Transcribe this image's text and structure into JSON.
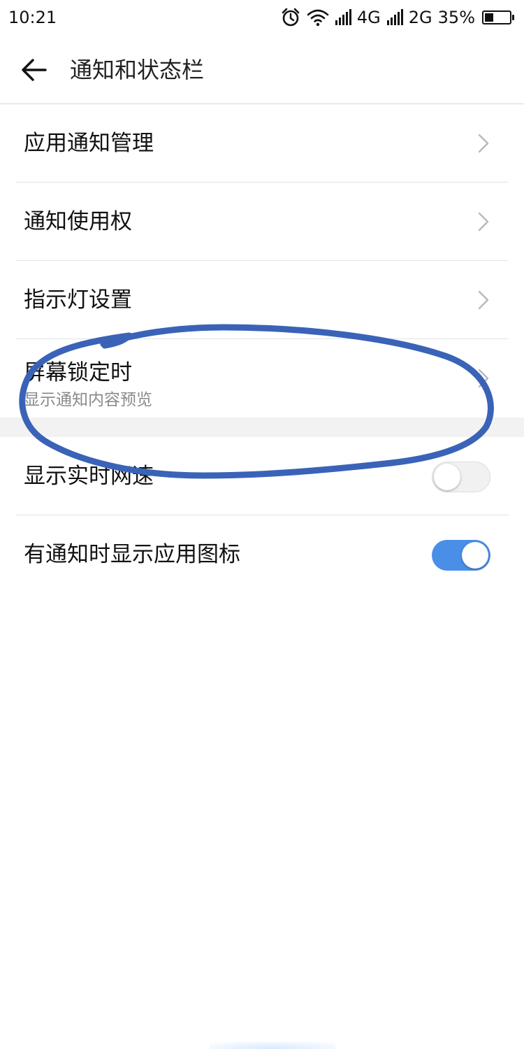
{
  "status_bar": {
    "time": "10:21",
    "net1": "4G",
    "net2": "2G",
    "battery": "35%",
    "battery_level": 0.35,
    "icons": [
      "alarm-icon",
      "wifi-icon",
      "signal-icon",
      "signal-icon",
      "battery-icon"
    ]
  },
  "header": {
    "title": "通知和状态栏",
    "back_icon": "back-arrow-icon"
  },
  "settings": {
    "items": [
      {
        "label": "应用通知管理",
        "type": "link"
      },
      {
        "label": "通知使用权",
        "type": "link"
      },
      {
        "label": "指示灯设置",
        "type": "link"
      },
      {
        "label": "屏幕锁定时",
        "sublabel": "显示通知内容预览",
        "type": "link"
      }
    ],
    "toggles": [
      {
        "label": "显示实时网速",
        "state": "off"
      },
      {
        "label": "有通知时显示应用图标",
        "state": "on"
      }
    ]
  },
  "colors": {
    "accent": "#4a8fe7",
    "annotation": "#3a63b8",
    "divider": "#e3e3e3",
    "section_gap": "#f2f2f2"
  }
}
